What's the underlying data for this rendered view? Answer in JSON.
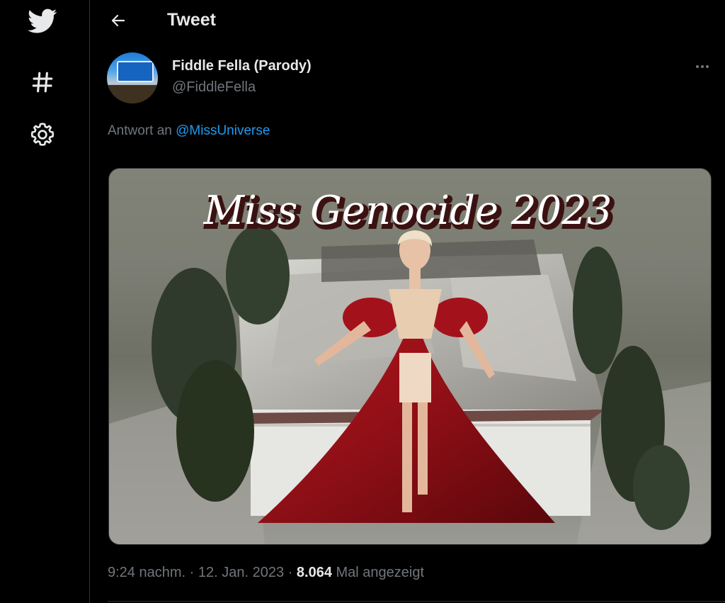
{
  "sidebar": {
    "icons": [
      "twitter-bird-icon",
      "hashtag-icon",
      "gear-icon"
    ]
  },
  "header": {
    "back_icon": "arrow-left-icon",
    "title": "Tweet"
  },
  "tweet": {
    "author": {
      "display_name": "Fiddle Fella (Parody)",
      "handle": "@FiddleFella"
    },
    "more_icon": "more-horizontal-icon",
    "reply_prefix": "Antwort an",
    "reply_mention": "@MissUniverse",
    "media": {
      "caption_text": "Miss Genocide 2023"
    },
    "time": "9:24 nachm.",
    "separator": "·",
    "date": "12. Jan. 2023",
    "views_count": "8.064",
    "views_label": "Mal angezeigt"
  },
  "colors": {
    "background": "#000000",
    "text_primary": "#e7e9ea",
    "text_secondary": "#71767b",
    "link": "#1d9bf0",
    "border": "#2f3336",
    "dress_red": "#8e0f16"
  }
}
